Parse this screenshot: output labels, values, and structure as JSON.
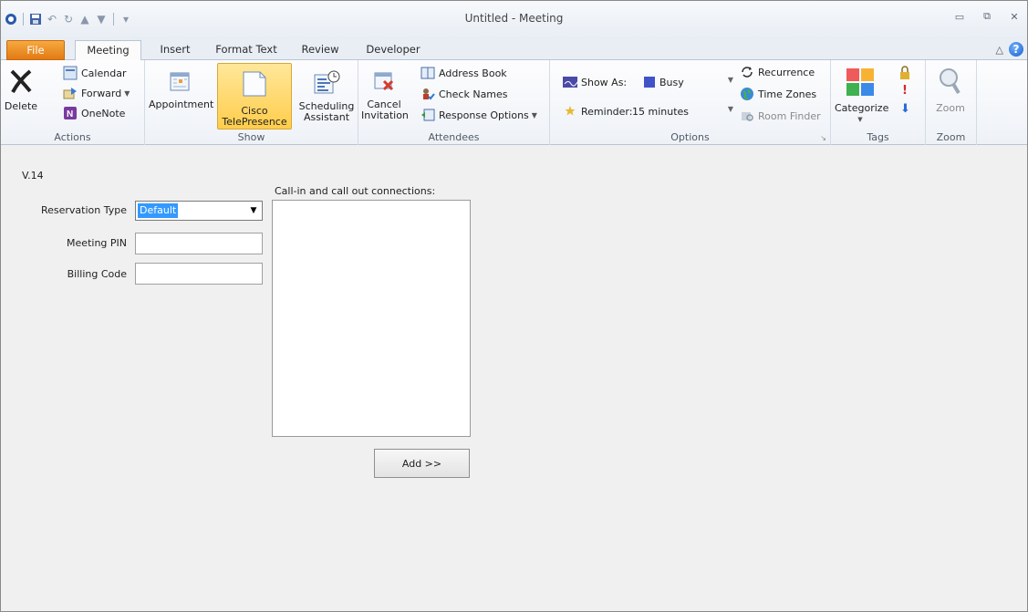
{
  "window": {
    "title": "Untitled - Meeting",
    "controls": {
      "minimize": "▭",
      "restore": "⧉",
      "close": "✕"
    }
  },
  "quick_access": {
    "icons": [
      "outlook-icon",
      "save-icon",
      "undo-icon",
      "redo-icon",
      "up-icon",
      "down-icon",
      "customize-icon"
    ]
  },
  "tabs": {
    "file": "File",
    "meeting": "Meeting",
    "insert": "Insert",
    "format_text": "Format Text",
    "review": "Review",
    "developer": "Developer"
  },
  "ribbon": {
    "actions": {
      "label": "Actions",
      "delete": "Delete",
      "calendar": "Calendar",
      "forward": "Forward",
      "onenote": "OneNote"
    },
    "show": {
      "label": "Show",
      "appointment": "Appointment",
      "cisco_line1": "Cisco",
      "cisco_line2": "TelePresence",
      "sched_line1": "Scheduling",
      "sched_line2": "Assistant"
    },
    "attendees": {
      "label": "Attendees",
      "cancel_line1": "Cancel",
      "cancel_line2": "Invitation",
      "address_book": "Address Book",
      "check_names": "Check Names",
      "response_options": "Response Options"
    },
    "options": {
      "label": "Options",
      "show_as_label": "Show As:",
      "show_as_value": "Busy",
      "reminder_label": "Reminder:",
      "reminder_value": "15 minutes",
      "recurrence": "Recurrence",
      "time_zones": "Time Zones",
      "room_finder": "Room Finder"
    },
    "tags": {
      "label": "Tags",
      "categorize": "Categorize"
    },
    "zoom": {
      "label": "Zoom",
      "zoom": "Zoom"
    }
  },
  "form": {
    "version": "V.14",
    "reservation_type_label": "Reservation Type",
    "reservation_type_value": "Default",
    "meeting_pin_label": "Meeting PIN",
    "meeting_pin_value": "",
    "billing_code_label": "Billing Code",
    "billing_code_value": "",
    "callin_label": "Call-in and call out connections:",
    "add_button": "Add >>"
  },
  "colors": {
    "file_tab": "#e27a14",
    "cisco_highlight": "#ffd96b",
    "selection": "#3399ff"
  }
}
